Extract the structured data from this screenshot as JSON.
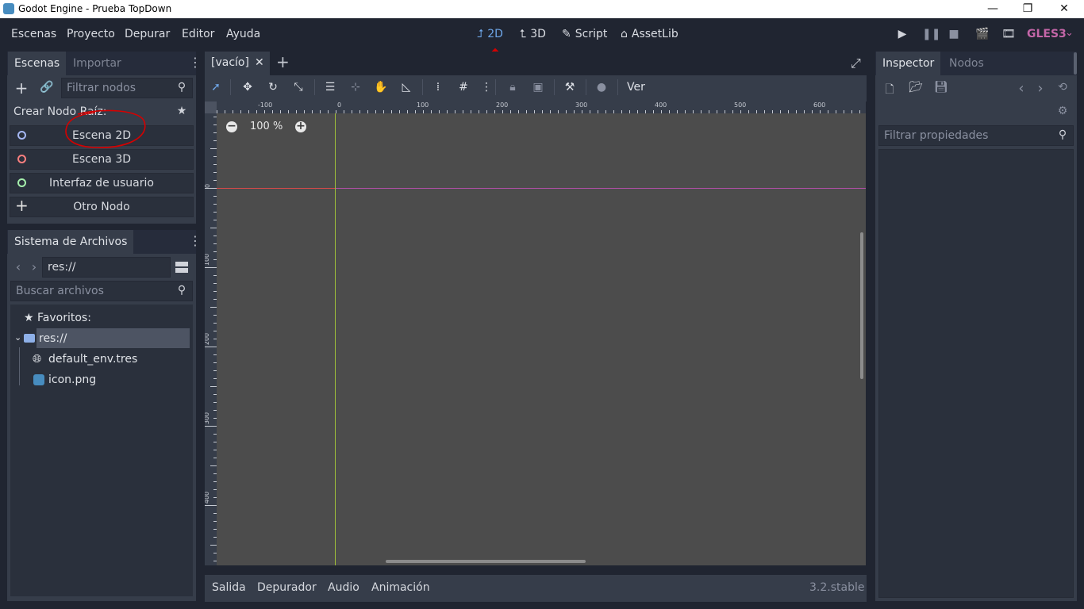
{
  "window": {
    "title": "Godot Engine - Prueba TopDown",
    "controls": {
      "minimize": "—",
      "restore": "❐",
      "close": "✕"
    }
  },
  "menu": {
    "items": [
      "Escenas",
      "Proyecto",
      "Depurar",
      "Editor",
      "Ayuda"
    ]
  },
  "workspaces": {
    "two_d": "2D",
    "three_d": "3D",
    "script": "Script",
    "assetlib": "AssetLib"
  },
  "renderer": "GLES3",
  "scene_dock": {
    "tabs": [
      "Escenas",
      "Importar"
    ],
    "filter_placeholder": "Filtrar nodos",
    "create_root_label": "Crear Nodo Raíz:",
    "root_options": [
      {
        "label": "Escena 2D",
        "color": "#a5b7f3"
      },
      {
        "label": "Escena 3D",
        "color": "#fc7f7f"
      },
      {
        "label": "Interfaz de usuario",
        "color": "#a5efac"
      },
      {
        "label": "Otro Nodo",
        "color": "#e0e0e0"
      }
    ]
  },
  "filesystem": {
    "tab": "Sistema de Archivos",
    "path": "res://",
    "search_placeholder": "Buscar archivos",
    "favorites_label": "Favoritos:",
    "root_folder": "res://",
    "files": [
      "default_env.tres",
      "icon.png"
    ]
  },
  "editor_tabs": {
    "scene_tab": "[vacío]",
    "close": "✕",
    "add": "+"
  },
  "canvas_toolbar": {
    "view_menu": "Ver"
  },
  "viewport": {
    "zoom_label": "100 %",
    "ruler_h_labels": [
      "-100",
      "0",
      "100",
      "200",
      "300",
      "400",
      "500",
      "600"
    ],
    "ruler_v_labels": [
      "0",
      "100",
      "200",
      "300",
      "400"
    ]
  },
  "bottom_panel": {
    "items": [
      "Salida",
      "Depurador",
      "Audio",
      "Animación"
    ],
    "version": "3.2.stable"
  },
  "inspector": {
    "tabs": [
      "Inspector",
      "Nodos"
    ],
    "filter_placeholder": "Filtrar propiedades"
  },
  "colors": {
    "accent": "#6ea6e8",
    "annotation": "#d60000",
    "renderer": "#c466a8"
  }
}
